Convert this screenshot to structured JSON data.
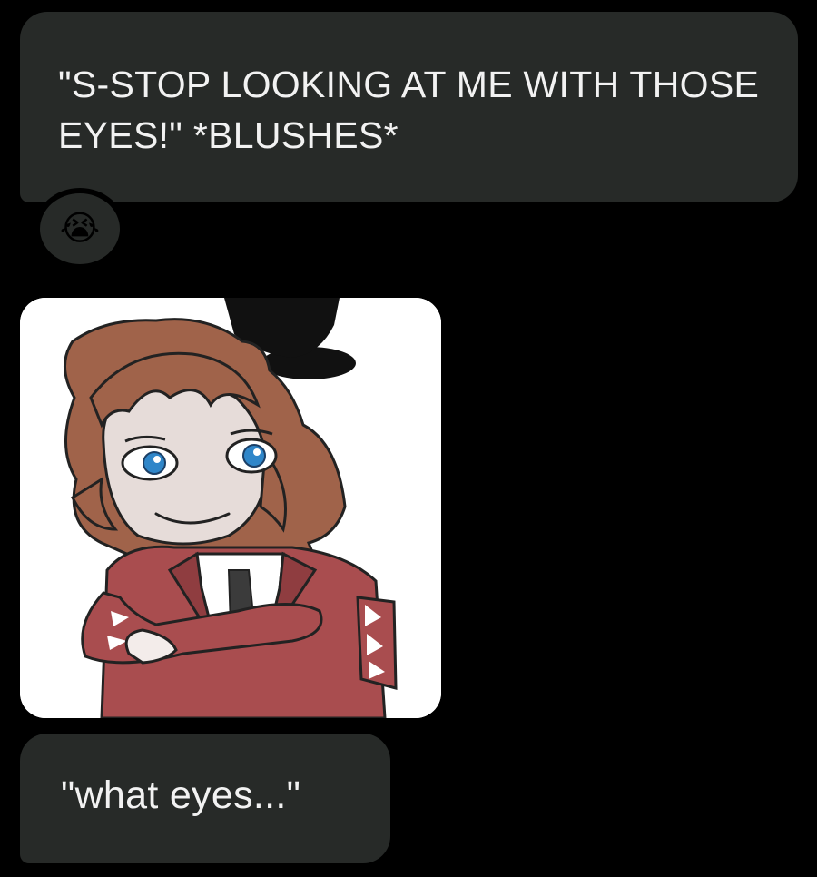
{
  "messages": [
    {
      "text": "\"S-STOP LOOKING AT ME WITH THOSE EYES!\" *BLUSHES*"
    },
    {
      "text": "\"what eyes...\""
    }
  ],
  "reaction": {
    "emoji": "😭",
    "icon": "loudly-crying-face"
  },
  "image": {
    "subject": "cartoon-character-crossed-arms"
  },
  "colors": {
    "background": "#000000",
    "bubble": "#272a28",
    "text": "#f2f2f2",
    "image_background": "#ffffff"
  }
}
